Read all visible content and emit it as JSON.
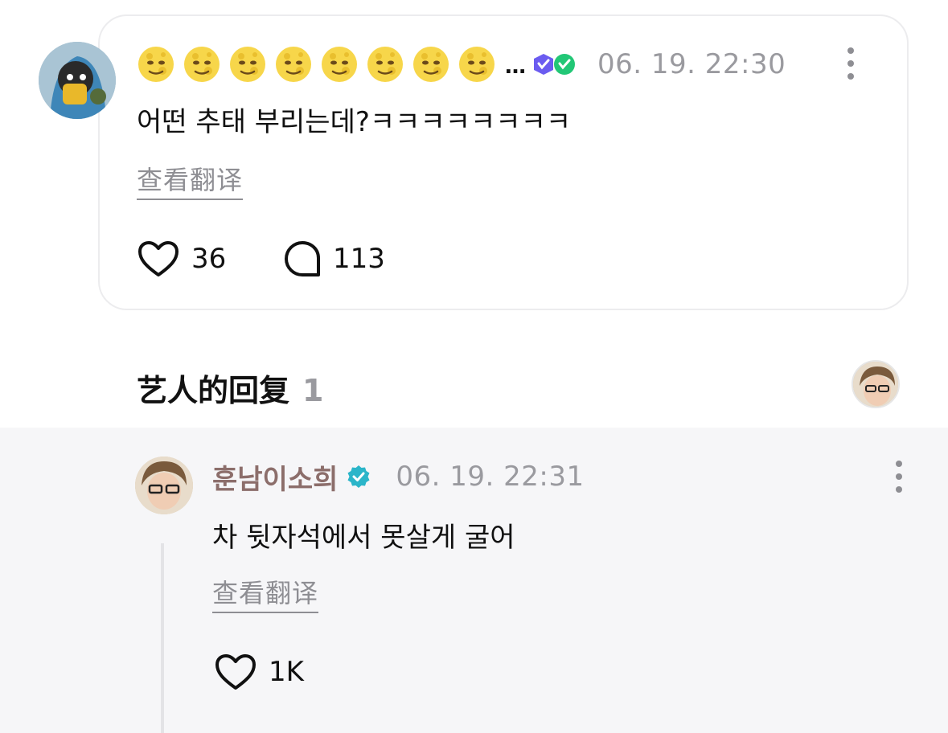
{
  "comment": {
    "avatar_icon": "user-avatar-icon",
    "emoji_count": 8,
    "emoji_icon": "full-moon-face-icon",
    "ellipsis": "…",
    "badges": [
      "purple-heart-badge-icon",
      "green-heart-badge-icon"
    ],
    "timestamp": "06. 19. 22:30",
    "body": "어떤 추태 부리는데?ㅋㅋㅋㅋㅋㅋㅋㅋ",
    "translate_label": "查看翻译",
    "likes": "36",
    "replies": "113"
  },
  "artist_reply_section": {
    "title": "艺人的回复",
    "count": "1"
  },
  "reply": {
    "author": "훈남이소희",
    "verified_icon": "verified-check-icon",
    "timestamp": "06. 19. 22:31",
    "body": "차 뒷자석에서 못살게 굴어",
    "translate_label": "查看翻译",
    "likes": "1K"
  },
  "colors": {
    "card_border": "#ececee",
    "muted_text": "#9a9a9f",
    "author_name": "#8c6e6b",
    "verified": "#2bb5c9",
    "reply_bg": "#f6f6f8"
  }
}
